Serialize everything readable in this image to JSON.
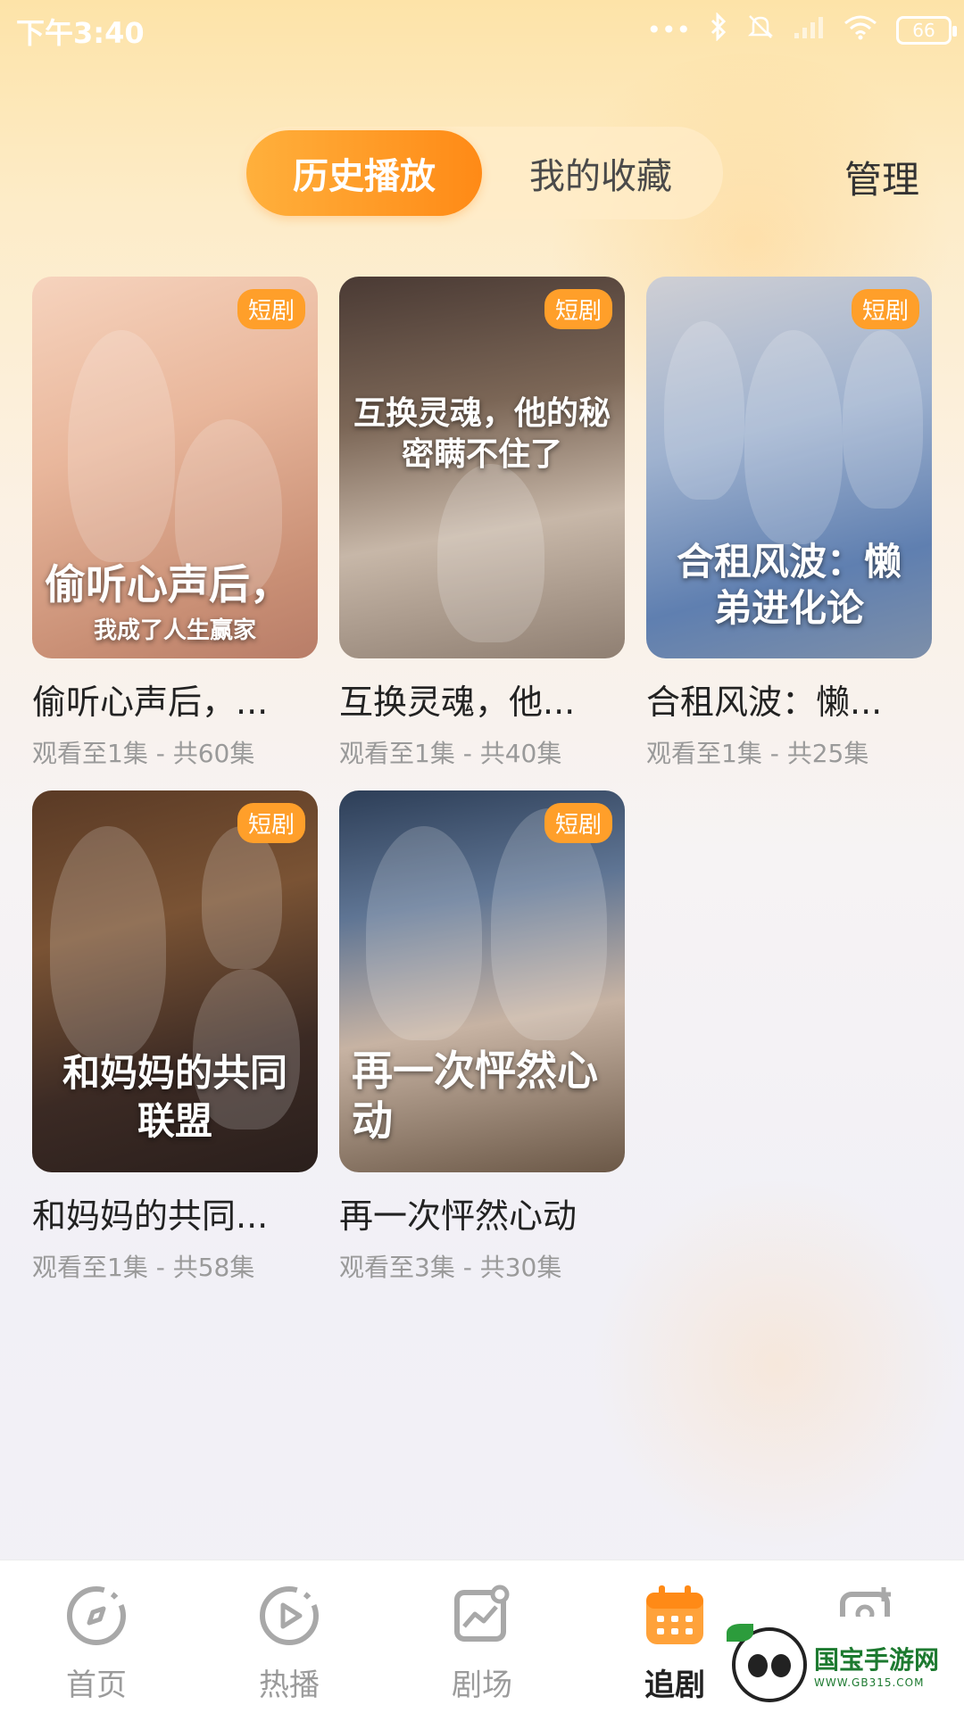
{
  "status_bar": {
    "time": "下午3:40",
    "battery": "66",
    "icons": [
      "more-dots-icon",
      "bluetooth-icon",
      "mute-icon",
      "signal-icon",
      "wifi-icon",
      "battery-icon"
    ]
  },
  "header": {
    "tabs": [
      {
        "label": "历史播放",
        "active": true
      },
      {
        "label": "我的收藏",
        "active": false
      }
    ],
    "manage_label": "管理"
  },
  "cards": [
    {
      "title": "偷听心声后，...",
      "progress": "观看至1集 - 共60集",
      "badge": "短剧",
      "poster_text": "偷听心声后，",
      "poster_sub": "我成了人生赢家"
    },
    {
      "title": "互换灵魂，他...",
      "progress": "观看至1集 - 共40集",
      "badge": "短剧",
      "poster_text": "互换灵魂，他的秘密瞒不住了",
      "poster_sub": ""
    },
    {
      "title": "合租风波：懒...",
      "progress": "观看至1集 - 共25集",
      "badge": "短剧",
      "poster_text": "合租风波：懒弟进化论",
      "poster_sub": ""
    },
    {
      "title": "和妈妈的共同...",
      "progress": "观看至1集 - 共58集",
      "badge": "短剧",
      "poster_text": "和妈妈的共同联盟",
      "poster_sub": ""
    },
    {
      "title": "再一次怦然心动",
      "progress": "观看至3集 - 共30集",
      "badge": "短剧",
      "poster_text": "再一次怦然心动",
      "poster_sub": ""
    }
  ],
  "bottom_nav": [
    {
      "label": "首页",
      "icon": "compass-icon",
      "active": false
    },
    {
      "label": "热播",
      "icon": "play-circle-icon",
      "active": false
    },
    {
      "label": "剧场",
      "icon": "chart-image-icon",
      "active": false
    },
    {
      "label": "追剧",
      "icon": "calendar-icon",
      "active": true
    },
    {
      "label": "",
      "icon": "profile-add-icon",
      "active": false
    }
  ],
  "watermark": {
    "title": "国宝手游网",
    "url": "WWW.GB315.COM"
  },
  "colors": {
    "accent": "#ff8a16",
    "badge": "#ff9f2a"
  }
}
